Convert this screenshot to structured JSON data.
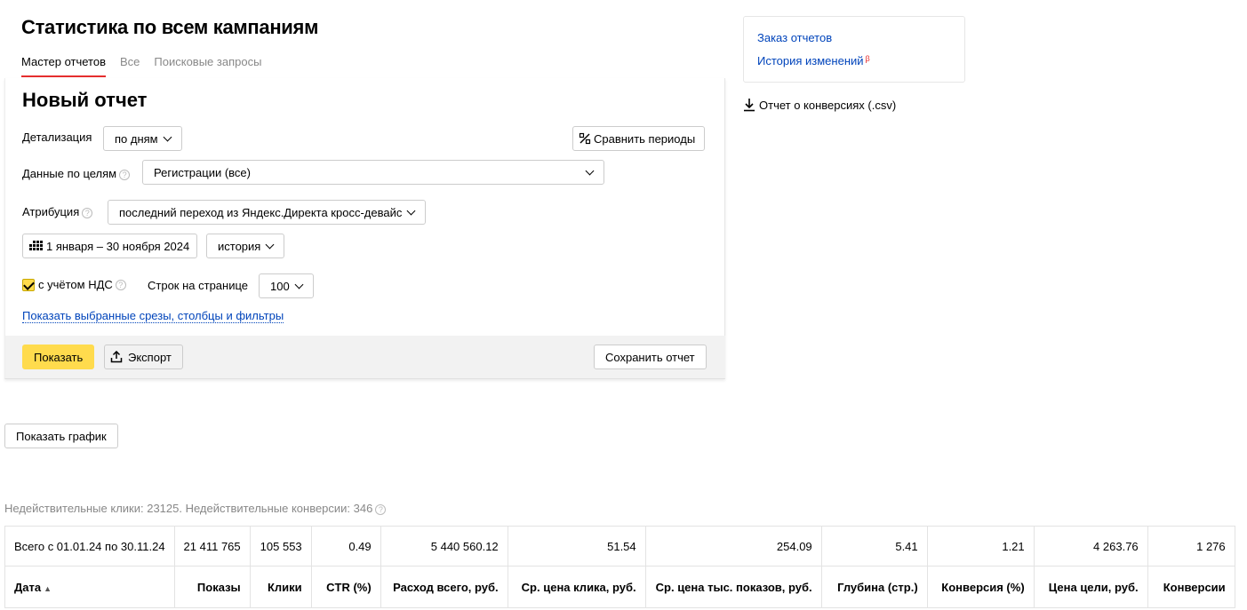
{
  "page": {
    "title": "Статистика по всем кампаниям",
    "tabs": [
      "Мастер отчетов",
      "Все",
      "Поисковые запросы"
    ]
  },
  "report": {
    "title": "Новый отчет",
    "detail_label": "Детализация",
    "detail_value": "по дням",
    "compare_label": "Сравнить периоды",
    "goals_label": "Данные по целям",
    "goals_value": "Регистрации (все)",
    "attribution_label": "Атрибуция",
    "attribution_value": "последний переход из Яндекс.Директа кросс-девайс",
    "date_range": "1 января – 30 ноября 2024",
    "history_value": "история",
    "vat_label": "с учётом НДС",
    "rows_label": "Строк на странице",
    "rows_value": "100",
    "show_filters_link": "Показать выбранные срезы, столбцы и фильтры",
    "show_button": "Показать",
    "export_button": "Экспорт",
    "save_button": "Сохранить отчет"
  },
  "sidebar": {
    "order_reports": "Заказ отчетов",
    "history": "История изменений",
    "history_badge": "β",
    "csv_link": "Отчет о конверсиях (.csv)"
  },
  "show_chart_button": "Показать график",
  "invalid_text": "Недействительные клики: 23125. Недействительные конверсии: 346",
  "table": {
    "total": [
      "Всего с 01.01.24 по 30.11.24",
      "21 411 765",
      "105 553",
      "0.49",
      "5 440 560.12",
      "51.54",
      "254.09",
      "5.41",
      "1.21",
      "4 263.76",
      "1 276"
    ],
    "headers": [
      "Дата",
      "Показы",
      "Клики",
      "CTR (%)",
      "Расход всего, руб.",
      "Ср. цена клика, руб.",
      "Ср. цена тыс. показов, руб.",
      "Глубина (стр.)",
      "Конверсия (%)",
      "Цена цели, руб.",
      "Конверсии"
    ],
    "sort_indicator": "▲"
  }
}
